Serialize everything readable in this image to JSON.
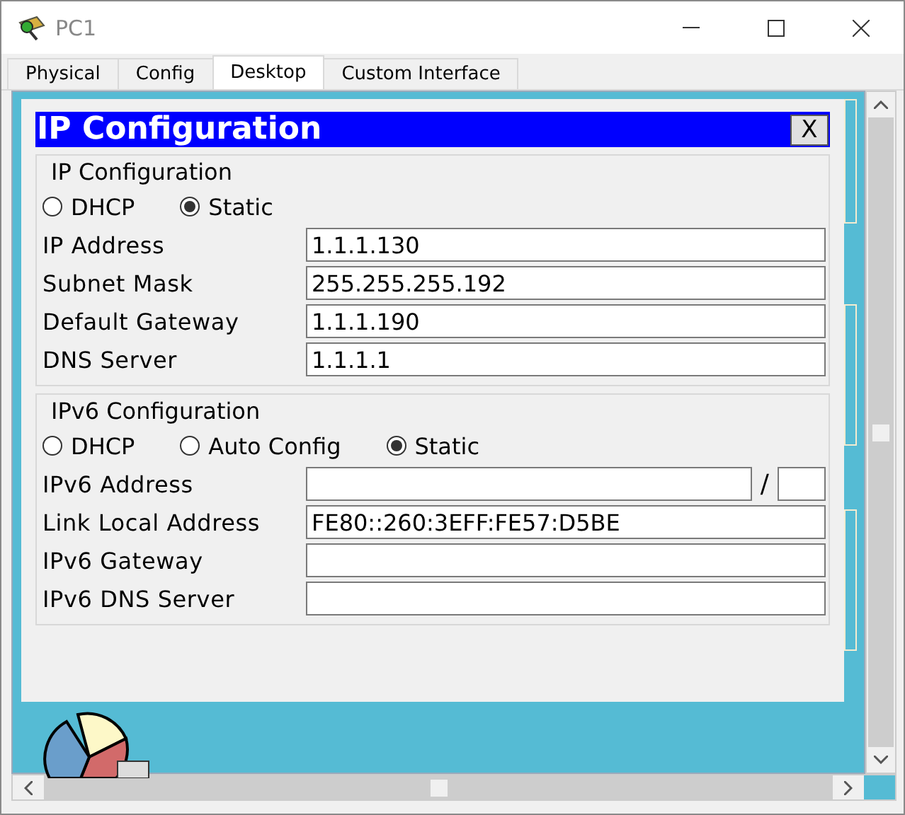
{
  "window": {
    "title": "PC1"
  },
  "tabs": [
    {
      "label": "Physical",
      "selected": false
    },
    {
      "label": "Config",
      "selected": false
    },
    {
      "label": "Desktop",
      "selected": true
    },
    {
      "label": "Custom Interface",
      "selected": false
    }
  ],
  "dialog": {
    "title": "IP Configuration",
    "close": "X",
    "sections": [
      {
        "legend": "IP Configuration",
        "modes": [
          {
            "label": "DHCP",
            "selected": false
          },
          {
            "label": "Static",
            "selected": true
          }
        ],
        "fields": [
          {
            "label": "IP Address",
            "value": "1.1.1.130"
          },
          {
            "label": "Subnet Mask",
            "value": "255.255.255.192"
          },
          {
            "label": "Default Gateway",
            "value": "1.1.1.190"
          },
          {
            "label": "DNS Server",
            "value": "1.1.1.1"
          }
        ]
      },
      {
        "legend": "IPv6 Configuration",
        "modes": [
          {
            "label": "DHCP",
            "selected": false
          },
          {
            "label": "Auto Config",
            "selected": false
          },
          {
            "label": "Static",
            "selected": true
          }
        ],
        "fields": [
          {
            "label": "IPv6 Address",
            "kind": "prefix",
            "separator": "/"
          },
          {
            "label": "Link Local Address",
            "value": "FE80::260:3EFF:FE57:D5BE"
          },
          {
            "label": "IPv6 Gateway"
          },
          {
            "label": "IPv6 DNS Server"
          }
        ]
      }
    ]
  }
}
